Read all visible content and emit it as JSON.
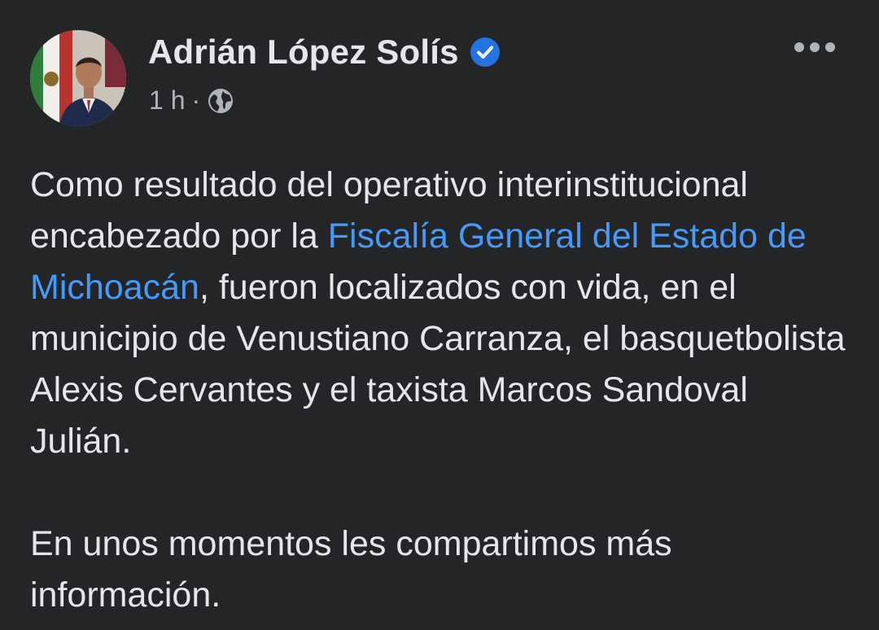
{
  "author": {
    "name": "Adrián López Solís",
    "verified": true
  },
  "meta": {
    "time": "1 h",
    "separator": "·",
    "audience_icon": "globe-icon"
  },
  "post": {
    "p1_before": "Como resultado del operativo interinstitucional encabezado por la ",
    "p1_link": "Fiscalía General del Estado de Michoacán",
    "p1_after": ", fueron localizados con vida, en el municipio de Venustiano Carranza, el basquetbolista Alexis Cervantes y el taxista Marcos Sandoval Julián.",
    "p2": "En unos momentos les compartimos más información."
  },
  "icons": {
    "verified": "verified-badge-icon",
    "more": "more-options-icon"
  },
  "colors": {
    "background": "#242526",
    "text_primary": "#e4e6eb",
    "text_secondary": "#b0b3b8",
    "link": "#4599ff",
    "verified_badge": "#2374e1"
  }
}
